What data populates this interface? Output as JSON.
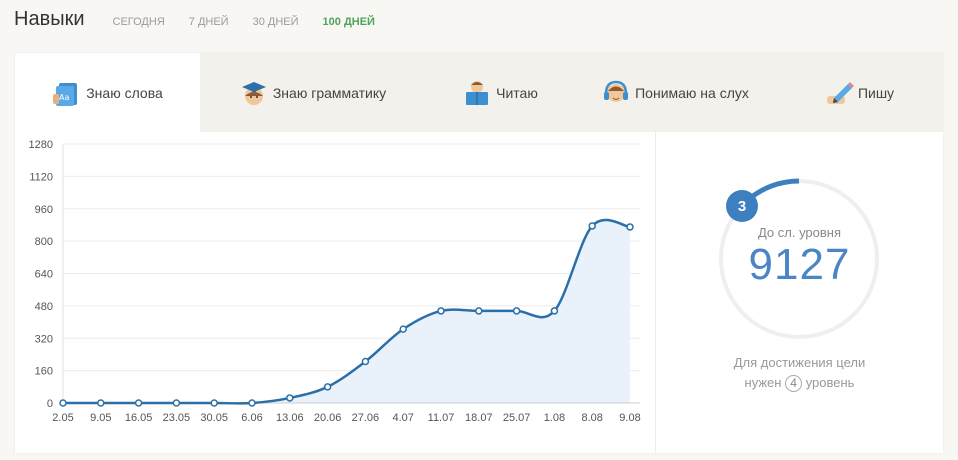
{
  "header": {
    "title": "Навыки",
    "periods": [
      "СЕГОДНЯ",
      "7 ДНЕЙ",
      "30 ДНЕЙ",
      "100 ДНЕЙ"
    ],
    "active_period": "100 ДНЕЙ",
    "accent_color": "#4ea35a"
  },
  "tabs": [
    {
      "label": "Знаю слова",
      "icon": "dictionary-book-icon",
      "active": true
    },
    {
      "label": "Знаю грамматику",
      "icon": "graduate-cap-icon",
      "active": false
    },
    {
      "label": "Читаю",
      "icon": "reading-person-icon",
      "active": false
    },
    {
      "label": "Понимаю на слух",
      "icon": "headphones-person-icon",
      "active": false
    },
    {
      "label": "Пишу",
      "icon": "pencil-writing-icon",
      "active": false
    }
  ],
  "level": {
    "current": "3",
    "caption": "До сл. уровня",
    "points_to_next": "9127",
    "progress_fraction": 0.06,
    "goal_text_1": "Для достижения цели",
    "goal_text_2_before": "нужен",
    "goal_level": "4",
    "goal_text_2_after": "уровень",
    "color": "#3d7fbf"
  },
  "chart_data": {
    "type": "area",
    "categories": [
      "2.05",
      "9.05",
      "16.05",
      "23.05",
      "30.05",
      "6.06",
      "13.06",
      "20.06",
      "27.06",
      "4.07",
      "11.07",
      "18.07",
      "25.07",
      "1.08",
      "8.08",
      "9.08"
    ],
    "values": [
      0,
      0,
      0,
      0,
      0,
      0,
      25,
      80,
      205,
      365,
      455,
      455,
      455,
      455,
      875,
      870
    ],
    "yticks": [
      0,
      160,
      320,
      480,
      640,
      800,
      960,
      1120,
      1280
    ],
    "ylim": [
      0,
      1280
    ],
    "grid": true,
    "line_color": "#2c6fa8",
    "fill_color": "#e9f1fa"
  }
}
